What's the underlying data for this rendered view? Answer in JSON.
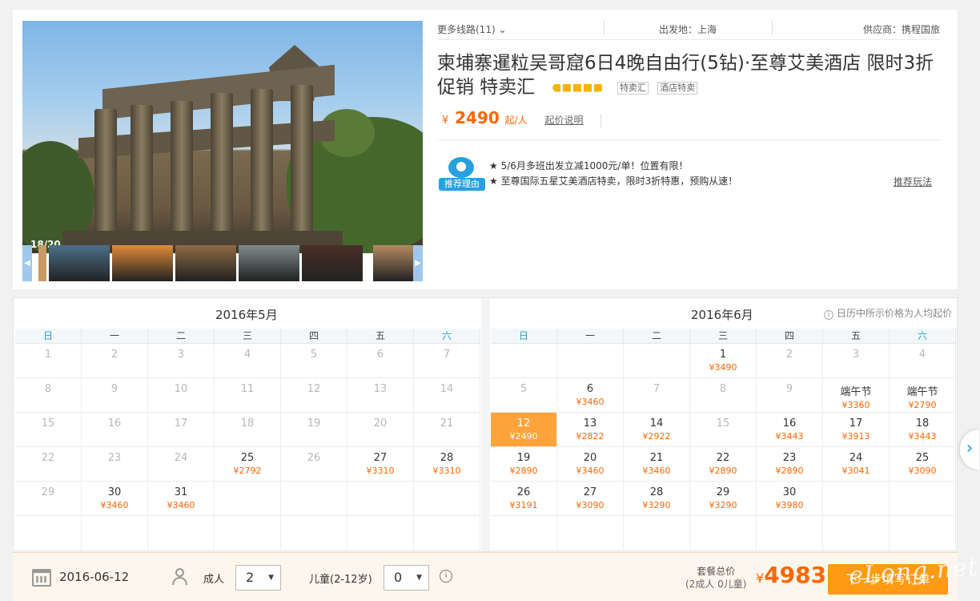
{
  "route_bar": {
    "more_routes": "更多线路(11)",
    "departure": "出发地：上海",
    "supplier": "供应商：携程国旅"
  },
  "product": {
    "title": "柬埔寨暹粒吴哥窟6日4晚自由行(5钻)·至尊艾美酒店 限时3折促销 特卖汇",
    "rating_diamonds": 5,
    "tags": [
      "特卖汇",
      "酒店特卖"
    ],
    "price_currency": "¥",
    "price_from": "2490",
    "price_unit": "起/人",
    "price_note": "起价说明"
  },
  "gallery": {
    "counter": "18/20",
    "thumbnail_colors": [
      "#4c6f88",
      "#e08a3a",
      "#8e6a44",
      "#7f8a8a",
      "#4a2e26",
      "#b58a62"
    ]
  },
  "recommend": {
    "badge": "推荐理由",
    "reasons": [
      "★ 5/6月多班出发立减1000元/单！位置有限！",
      "★ 至尊国际五星艾美酒店特卖，限时3折特惠，预购从速！"
    ],
    "link": "推荐玩法"
  },
  "calendar": {
    "price_hint": "日历中所示价格为人均起价",
    "weekdays": [
      "日",
      "一",
      "二",
      "三",
      "四",
      "五",
      "六"
    ],
    "months": [
      {
        "title": "2016年5月",
        "cells": [
          {
            "day": "1",
            "state": "past"
          },
          {
            "day": "2",
            "state": "past"
          },
          {
            "day": "3",
            "state": "past"
          },
          {
            "day": "4",
            "state": "past"
          },
          {
            "day": "5",
            "state": "past"
          },
          {
            "day": "6",
            "state": "past"
          },
          {
            "day": "7",
            "state": "past"
          },
          {
            "day": "8",
            "state": "past"
          },
          {
            "day": "9",
            "state": "past"
          },
          {
            "day": "10",
            "state": "past"
          },
          {
            "day": "11",
            "state": "past"
          },
          {
            "day": "12",
            "state": "past"
          },
          {
            "day": "13",
            "state": "past"
          },
          {
            "day": "14",
            "state": "past"
          },
          {
            "day": "15",
            "state": "past"
          },
          {
            "day": "16",
            "state": "past"
          },
          {
            "day": "17",
            "state": "past"
          },
          {
            "day": "18",
            "state": "past"
          },
          {
            "day": "19",
            "state": "past"
          },
          {
            "day": "20",
            "state": "past"
          },
          {
            "day": "21",
            "state": "past"
          },
          {
            "day": "22",
            "state": "past"
          },
          {
            "day": "23",
            "state": "past"
          },
          {
            "day": "24",
            "state": "past"
          },
          {
            "day": "25",
            "state": "avail",
            "price": "¥2792"
          },
          {
            "day": "26",
            "state": "past"
          },
          {
            "day": "27",
            "state": "avail",
            "price": "¥3310"
          },
          {
            "day": "28",
            "state": "avail",
            "price": "¥3310"
          },
          {
            "day": "29",
            "state": "past"
          },
          {
            "day": "30",
            "state": "avail",
            "price": "¥3460"
          },
          {
            "day": "31",
            "state": "avail",
            "price": "¥3460"
          },
          {
            "day": "",
            "state": "empty"
          },
          {
            "day": "",
            "state": "empty"
          },
          {
            "day": "",
            "state": "empty"
          },
          {
            "day": "",
            "state": "empty"
          },
          {
            "day": "",
            "state": "empty"
          },
          {
            "day": "",
            "state": "empty"
          },
          {
            "day": "",
            "state": "empty"
          },
          {
            "day": "",
            "state": "empty"
          },
          {
            "day": "",
            "state": "empty"
          },
          {
            "day": "",
            "state": "empty"
          },
          {
            "day": "",
            "state": "empty"
          }
        ]
      },
      {
        "title": "2016年6月",
        "cells": [
          {
            "day": "",
            "state": "empty"
          },
          {
            "day": "",
            "state": "empty"
          },
          {
            "day": "",
            "state": "empty"
          },
          {
            "day": "1",
            "state": "avail",
            "price": "¥3490"
          },
          {
            "day": "2",
            "state": "past"
          },
          {
            "day": "3",
            "state": "past"
          },
          {
            "day": "4",
            "state": "past"
          },
          {
            "day": "5",
            "state": "past"
          },
          {
            "day": "6",
            "state": "avail",
            "price": "¥3460"
          },
          {
            "day": "7",
            "state": "past"
          },
          {
            "day": "8",
            "state": "past"
          },
          {
            "day": "9",
            "state": "past"
          },
          {
            "day": "端午节",
            "state": "avail",
            "price": "¥3360"
          },
          {
            "day": "端午节",
            "state": "avail",
            "price": "¥2790"
          },
          {
            "day": "12",
            "state": "selected",
            "price": "¥2490"
          },
          {
            "day": "13",
            "state": "avail",
            "price": "¥2822"
          },
          {
            "day": "14",
            "state": "avail",
            "price": "¥2922"
          },
          {
            "day": "15",
            "state": "past"
          },
          {
            "day": "16",
            "state": "avail",
            "price": "¥3443"
          },
          {
            "day": "17",
            "state": "avail",
            "price": "¥3913"
          },
          {
            "day": "18",
            "state": "avail",
            "price": "¥3443"
          },
          {
            "day": "19",
            "state": "avail",
            "price": "¥2890"
          },
          {
            "day": "20",
            "state": "avail",
            "price": "¥3460"
          },
          {
            "day": "21",
            "state": "avail",
            "price": "¥3460"
          },
          {
            "day": "22",
            "state": "avail",
            "price": "¥2890"
          },
          {
            "day": "23",
            "state": "avail",
            "price": "¥2890"
          },
          {
            "day": "24",
            "state": "avail",
            "price": "¥3041"
          },
          {
            "day": "25",
            "state": "avail",
            "price": "¥3090"
          },
          {
            "day": "26",
            "state": "avail",
            "price": "¥3191"
          },
          {
            "day": "27",
            "state": "avail",
            "price": "¥3090"
          },
          {
            "day": "28",
            "state": "avail",
            "price": "¥3290"
          },
          {
            "day": "29",
            "state": "avail",
            "price": "¥3290"
          },
          {
            "day": "30",
            "state": "avail",
            "price": "¥3980"
          },
          {
            "day": "",
            "state": "empty"
          },
          {
            "day": "",
            "state": "empty"
          },
          {
            "day": "",
            "state": "empty"
          },
          {
            "day": "",
            "state": "empty"
          },
          {
            "day": "",
            "state": "empty"
          },
          {
            "day": "",
            "state": "empty"
          },
          {
            "day": "",
            "state": "empty"
          },
          {
            "day": "",
            "state": "empty"
          },
          {
            "day": "",
            "state": "empty"
          }
        ]
      }
    ]
  },
  "booking": {
    "date": "2016-06-12",
    "adult_label": "成人",
    "adult_value": "2",
    "child_label": "儿童(2-12岁)",
    "child_value": "0",
    "total_label": "套餐总价",
    "total_sub": "(2成人 0儿童)",
    "total_currency": "¥",
    "total_price": "4983",
    "next_button": "下一步填写订单"
  },
  "watermark": "eLong.net",
  "colors": {
    "accent_orange": "#ff6600",
    "selected_day": "#ffa33a",
    "weekend_blue": "#1aa0d8",
    "button": "#ff9a14"
  }
}
